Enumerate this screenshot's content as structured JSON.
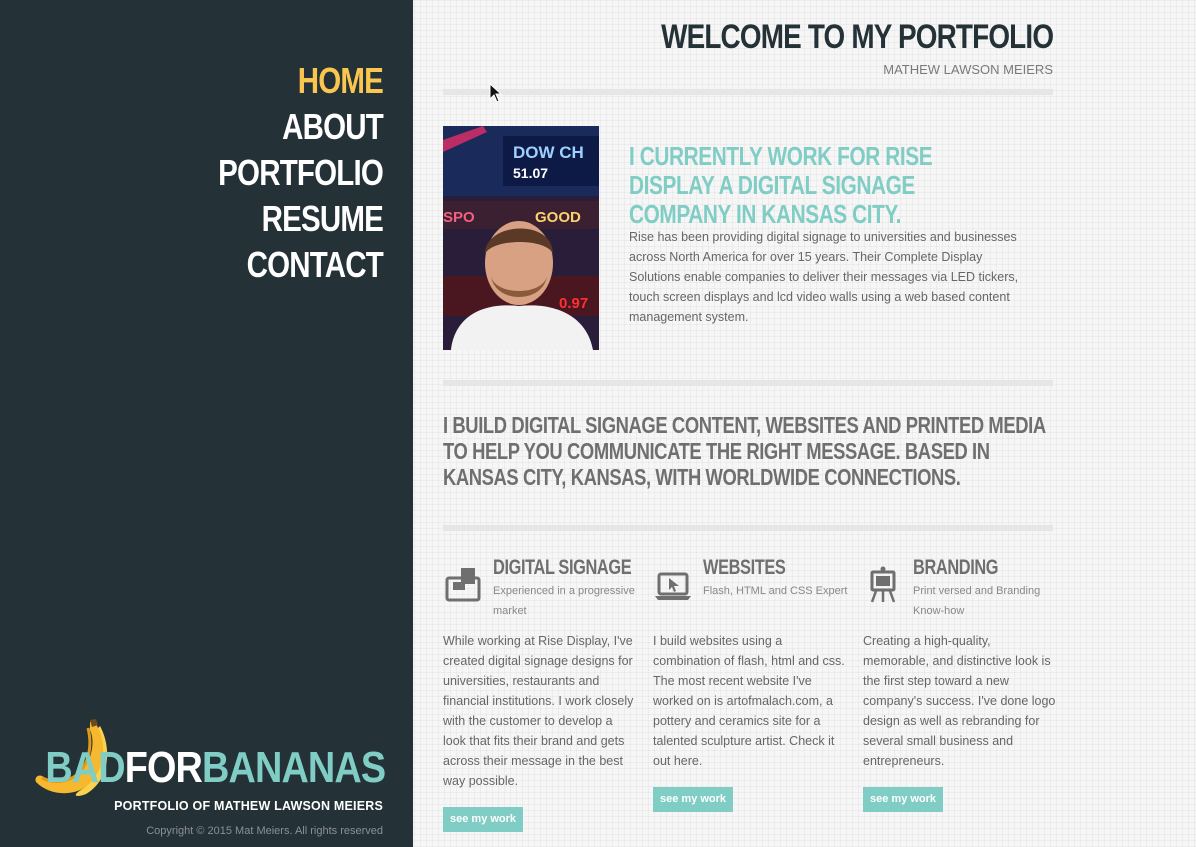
{
  "nav": {
    "items": [
      {
        "label": "HOME",
        "active": true
      },
      {
        "label": "ABOUT",
        "active": false
      },
      {
        "label": "PORTFOLIO",
        "active": false
      },
      {
        "label": "RESUME",
        "active": false
      },
      {
        "label": "CONTACT",
        "active": false
      }
    ]
  },
  "brand": {
    "logo_part1": "BAD",
    "logo_part2": "FOR",
    "logo_part3": "BANANAS",
    "tagline": "PORTFOLIO OF MATHEW LAWSON MEIERS",
    "copyright": "Copyright © 2015 Mat Meiers. All rights reserved",
    "icon": "banana-icon"
  },
  "header": {
    "title": "WELCOME TO MY PORTFOLIO",
    "subtitle": "MATHEW LAWSON MEIERS"
  },
  "intro": {
    "heading": "I CURRENTLY WORK FOR RISE DISPLAY A DIGITAL SIGNAGE COMPANY IN KANSAS CITY.",
    "text": "Rise has been providing digital signage to universities and businesses across North America for over 15 years. Their Complete Display Solutions enable companies to deliver their messages via LED tickers, touch screen displays and lcd video walls using a web based content management system."
  },
  "statement": "I BUILD DIGITAL SIGNAGE CONTENT, WEBSITES AND PRINTED MEDIA TO HELP YOU COMMUNICATE THE RIGHT MESSAGE. BASED IN KANSAS CITY, KANSAS, WITH WORLDWIDE CONNECTIONS.",
  "services": [
    {
      "title": "DIGITAL SIGNAGE",
      "subtitle": "Experienced in a progressive market",
      "body": "While working at Rise Display, I've created digital signage designs for universities, restaurants and financial institutions. I work closely with the customer to develop a look that fits their brand and gets across their message in the best way possible.",
      "button": "see my work",
      "icon": "signage-icon"
    },
    {
      "title": "WEBSITES",
      "subtitle": "Flash, HTML and CSS Expert",
      "body": "I build websites using a combination of flash, html and css. The most recent website I've worked on is artofmalach.com, a pottery and ceramics site for a talented sculpture artist. Check it out here.",
      "button": "see my work",
      "icon": "laptop-icon"
    },
    {
      "title": "BRANDING",
      "subtitle": "Print versed and Branding Know-how",
      "body": "Creating a high-quality, memorable, and distinctive look is the first step toward a new company's success. I've done logo design as well as rebranding for several small business and entrepreneurs.",
      "button": "see my work",
      "icon": "easel-icon"
    }
  ],
  "colors": {
    "sidebar": "#243137",
    "accent_teal": "#7fcdc4",
    "accent_yellow": "#f9c74f"
  }
}
